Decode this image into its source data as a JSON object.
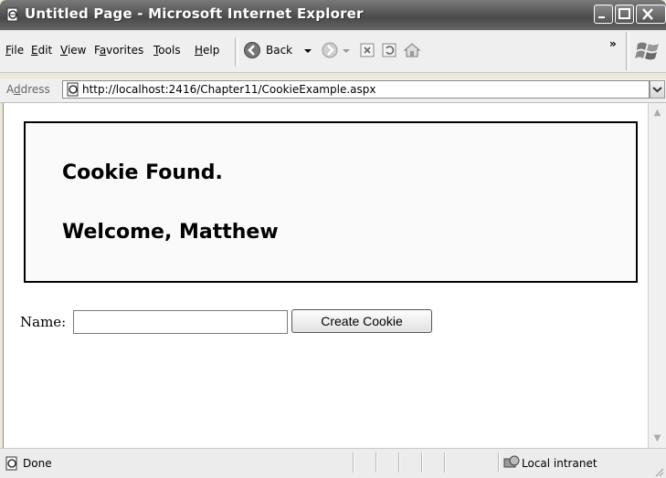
{
  "window": {
    "title": "Untitled Page - Microsoft Internet Explorer"
  },
  "menubar": {
    "items": [
      {
        "label": "File",
        "accel": "F",
        "rest": "ile"
      },
      {
        "label": "Edit",
        "accel": "E",
        "rest": "dit"
      },
      {
        "label": "View",
        "accel": "V",
        "rest": "iew"
      },
      {
        "label": "Favorites",
        "accel": "a",
        "pre": "F",
        "rest": "vorites"
      },
      {
        "label": "Tools",
        "accel": "T",
        "rest": "ools"
      },
      {
        "label": "Help",
        "accel": "H",
        "rest": "elp"
      }
    ],
    "back_label": "Back",
    "overflow": "»"
  },
  "address": {
    "label_pre": "A",
    "label_accel": "d",
    "label_rest": "dress",
    "url": "http://localhost:2416/Chapter11/CookieExample.aspx"
  },
  "page": {
    "line1": "Cookie Found.",
    "line2": "Welcome, Matthew",
    "name_label": "Name:",
    "name_value": "",
    "button_label": "Create Cookie"
  },
  "status": {
    "text": "Done",
    "zone": "Local intranet"
  },
  "colors": {
    "titlebar": "#5a5a5a",
    "chrome": "#efefef",
    "panel_border": "#000000"
  }
}
